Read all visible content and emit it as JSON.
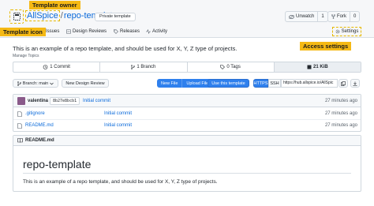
{
  "annotations": {
    "template_owner": "Template owner",
    "template_icon": "Template icon",
    "access_settings": "Access settings"
  },
  "header": {
    "owner": "AllSpice",
    "separator": "/",
    "repo": "repo-template",
    "template_badge": "Private template",
    "unwatch_label": "Unwatch",
    "unwatch_count": "1",
    "fork_label": "Fork",
    "fork_count": "0"
  },
  "tabs": [
    {
      "label": "Issues"
    },
    {
      "label": "Design Reviews"
    },
    {
      "label": "Releases"
    },
    {
      "label": "Activity"
    },
    {
      "label": "Settings"
    }
  ],
  "repo": {
    "description": "This is an example of a repo template, and should be used for X, Y, Z type of projects.",
    "topics_label": "Manage Topics"
  },
  "stats": [
    {
      "label": "1 Commit"
    },
    {
      "label": "1 Branch"
    },
    {
      "label": "0 Tags"
    },
    {
      "label": "21 KiB"
    }
  ],
  "toolbar": {
    "branch_label": "Branch: main",
    "new_design_review": "New Design Review",
    "new_file": "New File",
    "upload_file": "Upload File",
    "use_template": "Use this template",
    "https": "HTTPS",
    "ssh": "SSH",
    "clone_url": "https://hub.allspice.io/AllSpic"
  },
  "latest_commit": {
    "author": "valentina",
    "sha": "8b27e8bcb1",
    "message": "Initial commit",
    "time": "27 minutes ago"
  },
  "files": [
    {
      "name": ".gitignore",
      "message": "Initial commit",
      "time": "27 minutes ago"
    },
    {
      "name": "README.md",
      "message": "Initial commit",
      "time": "27 minutes ago"
    }
  ],
  "readme": {
    "filename": "README.md",
    "title": "repo-template",
    "body": "This is an example of a repo template, and should be used for X, Y, Z type of projects."
  },
  "colors": {
    "callout": "#f5b915",
    "link": "#0969da",
    "primary_button": "#2f80ed"
  }
}
